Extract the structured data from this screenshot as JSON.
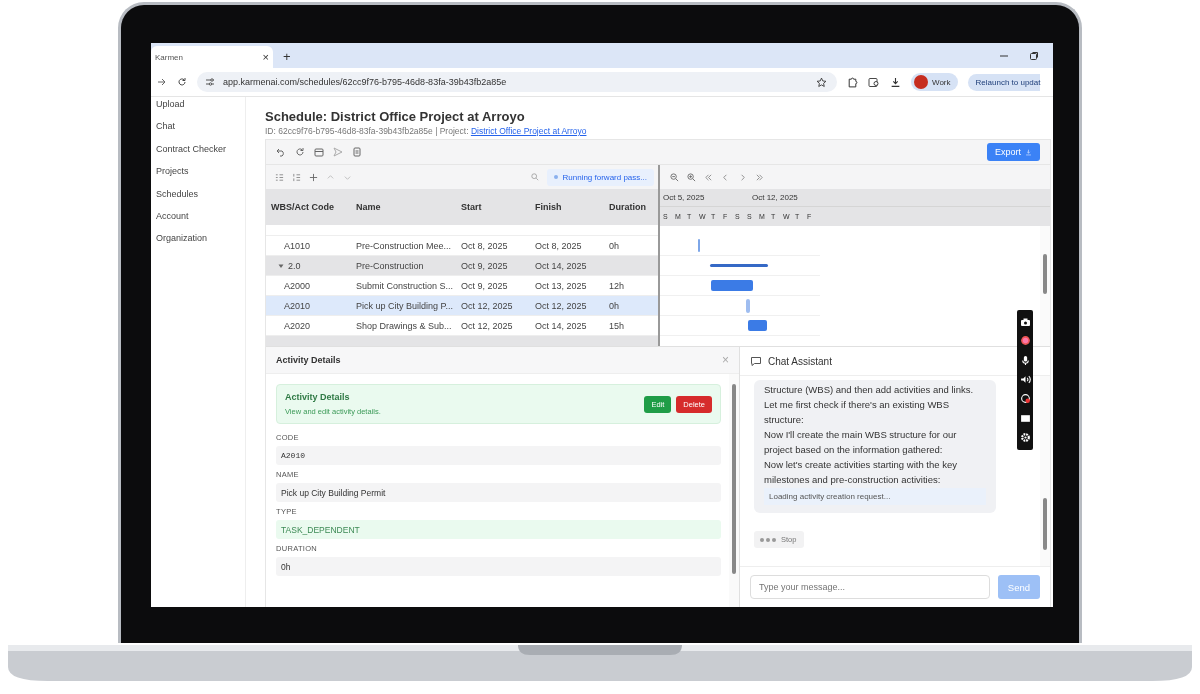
{
  "browser": {
    "tab": {
      "title": "Karmen",
      "close": "×",
      "new_tab": "+"
    },
    "url": "app.karmenai.com/schedules/62cc9f76-b795-46d8-83fa-39b43fb2a85e",
    "profile": "Work",
    "relaunch": "Relaunch to updat"
  },
  "sidebar": {
    "items": [
      {
        "label": "Upload",
        "selected": false
      },
      {
        "label": "Chat",
        "selected": false
      },
      {
        "label": "Contract Checker",
        "selected": false
      },
      {
        "label": "Projects",
        "selected": false
      },
      {
        "label": "Schedules",
        "selected": false
      },
      {
        "label": "Account",
        "selected": false
      },
      {
        "label": "Organization",
        "selected": false
      }
    ]
  },
  "schedule": {
    "title": "Schedule: District Office Project at Arroyo",
    "id_line": "ID: 62cc9f76-b795-46d8-83fa-39b43fb2a85e | Project: ",
    "project_link": "District Office Project at Arroyo",
    "export": "Export"
  },
  "status_badge": "Running forward pass...",
  "table": {
    "columns": [
      "WBS/Act Code",
      "Name",
      "Start",
      "Finish",
      "Duration"
    ],
    "rows": [
      {
        "kind": "task",
        "selected": false,
        "code": "A1010",
        "name": "Pre-Construction Mee...",
        "start": "Oct 8, 2025",
        "finish": "Oct 8, 2025",
        "duration": "0h"
      },
      {
        "kind": "group",
        "selected": false,
        "code": "2.0",
        "name": "Pre-Construction",
        "start": "Oct 9, 2025",
        "finish": "Oct 14, 2025",
        "duration": ""
      },
      {
        "kind": "task",
        "selected": false,
        "code": "A2000",
        "name": "Submit Construction S...",
        "start": "Oct 9, 2025",
        "finish": "Oct 13, 2025",
        "duration": "12h"
      },
      {
        "kind": "task",
        "selected": true,
        "code": "A2010",
        "name": "Pick up City Building P...",
        "start": "Oct 12, 2025",
        "finish": "Oct 12, 2025",
        "duration": "0h"
      },
      {
        "kind": "task",
        "selected": false,
        "code": "A2020",
        "name": "Shop Drawings & Sub...",
        "start": "Oct 12, 2025",
        "finish": "Oct 14, 2025",
        "duration": "15h"
      }
    ]
  },
  "gantt": {
    "weeks": [
      "Oct 5, 2025",
      "Oct 12, 2025"
    ],
    "days": [
      "S",
      "M",
      "T",
      "W",
      "T",
      "F",
      "S",
      "S",
      "M",
      "T",
      "W",
      "T",
      "F"
    ]
  },
  "activity_details": {
    "title": "Activity Details",
    "card_title": "Activity Details",
    "card_subtitle": "View and edit activity details.",
    "edit": "Edit",
    "delete": "Delete",
    "close": "×",
    "fields": [
      {
        "label": "CODE",
        "value": "A2010",
        "kind": "mono"
      },
      {
        "label": "NAME",
        "value": "Pick up City Building Permit",
        "kind": "plain"
      },
      {
        "label": "TYPE",
        "value": "TASK_DEPENDENT",
        "kind": "highlight"
      },
      {
        "label": "DURATION",
        "value": "0h",
        "kind": "plain"
      }
    ]
  },
  "chat": {
    "title": "Chat Assistant",
    "messages": [
      "Structure (WBS) and then add activities and links.",
      "Let me first check if there's an existing WBS structure:",
      "Now I'll create the main WBS structure for our project based on the information gathered:",
      "Now let's create activities starting with the key milestones and pre-construction activities:"
    ],
    "loading": "Loading activity creation request...",
    "stop": "Stop",
    "placeholder": "Type your message...",
    "send": "Send",
    "send_disabled": true
  }
}
